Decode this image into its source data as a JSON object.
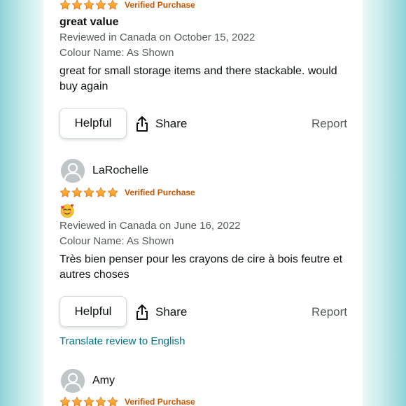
{
  "colors": {
    "star": "#ffa41c",
    "verified": "#c45500",
    "link": "#007185",
    "meta": "#565959"
  },
  "reviews": [
    {
      "reviewer": "",
      "rating": 5,
      "verified_label": "Verified Purchase",
      "title": "great value",
      "date_line": "Reviewed in Canada on October 15, 2022",
      "variant_line": "Colour Name: As Shown",
      "body": "great for small storage items and there stackable. would buy again",
      "helpful_label": "Helpful",
      "share_label": "Share",
      "report_label": "Report"
    },
    {
      "reviewer": "LaRochelle",
      "rating": 5,
      "verified_label": "Verified Purchase",
      "title_emoji": "smiling-face-with-hearts-emoji",
      "date_line": "Reviewed in Canada on June 16, 2022",
      "variant_line": "Colour Name: As Shown",
      "body": "Très bien penser pour les crayons de cire à bois feutre et autres choses",
      "helpful_label": "Helpful",
      "share_label": "Share",
      "report_label": "Report",
      "translate_label": "Translate review to English"
    },
    {
      "reviewer": "Amy",
      "rating": 5,
      "verified_label": "Verified Purchase"
    }
  ]
}
